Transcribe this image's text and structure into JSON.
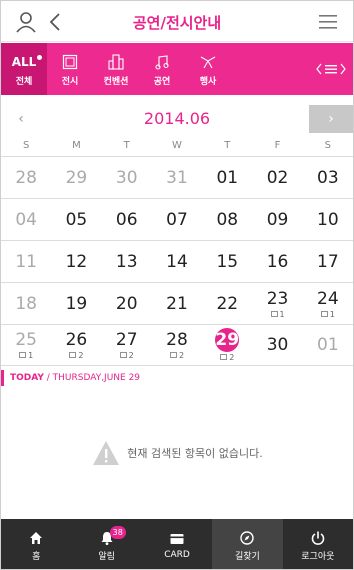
{
  "header": {
    "title": "공연/전시안내"
  },
  "categories": [
    {
      "label": "전체",
      "top": "ALL",
      "active": true
    },
    {
      "label": "전시",
      "icon": "frame-icon"
    },
    {
      "label": "컨벤션",
      "icon": "building-icon"
    },
    {
      "label": "공연",
      "icon": "music-note-icon"
    },
    {
      "label": "행사",
      "icon": "ribbon-icon"
    }
  ],
  "month": {
    "label": "2014.06",
    "prev": "‹",
    "next": "›"
  },
  "weekdays": [
    "S",
    "M",
    "T",
    "W",
    "T",
    "F",
    "S"
  ],
  "weeks": [
    [
      {
        "d": "28",
        "m": true
      },
      {
        "d": "29",
        "m": true
      },
      {
        "d": "30",
        "m": true
      },
      {
        "d": "31",
        "m": true
      },
      {
        "d": "01"
      },
      {
        "d": "02"
      },
      {
        "d": "03"
      }
    ],
    [
      {
        "d": "04",
        "m": true
      },
      {
        "d": "05"
      },
      {
        "d": "06"
      },
      {
        "d": "07"
      },
      {
        "d": "08"
      },
      {
        "d": "09"
      },
      {
        "d": "10"
      }
    ],
    [
      {
        "d": "11",
        "m": true
      },
      {
        "d": "12"
      },
      {
        "d": "13"
      },
      {
        "d": "14"
      },
      {
        "d": "15"
      },
      {
        "d": "16"
      },
      {
        "d": "17"
      }
    ],
    [
      {
        "d": "18",
        "m": true
      },
      {
        "d": "19"
      },
      {
        "d": "20"
      },
      {
        "d": "21"
      },
      {
        "d": "22"
      },
      {
        "d": "23",
        "c": "1"
      },
      {
        "d": "24",
        "c": "1"
      }
    ],
    [
      {
        "d": "25",
        "m": true,
        "c": "1"
      },
      {
        "d": "26",
        "c": "2"
      },
      {
        "d": "27",
        "c": "2"
      },
      {
        "d": "28",
        "c": "2"
      },
      {
        "d": "29",
        "c": "2",
        "t": true
      },
      {
        "d": "30"
      },
      {
        "d": "01",
        "m": true
      }
    ]
  ],
  "today": {
    "label": "TODAY",
    "date": " / THURSDAY,JUNE 29"
  },
  "empty_message": "현재 검색된 항목이 없습니다.",
  "tabs": [
    {
      "label": "홈",
      "icon": "home-icon"
    },
    {
      "label": "알림",
      "icon": "bell-icon",
      "badge": "38"
    },
    {
      "label": "CARD",
      "icon": "card-icon"
    },
    {
      "label": "길찾기",
      "icon": "compass-icon",
      "active": true
    },
    {
      "label": "로그아웃",
      "icon": "power-icon"
    }
  ],
  "colors": {
    "accent": "#e8248c",
    "catbar": "#ec2a8f",
    "tabbar": "#2d2d2d"
  }
}
